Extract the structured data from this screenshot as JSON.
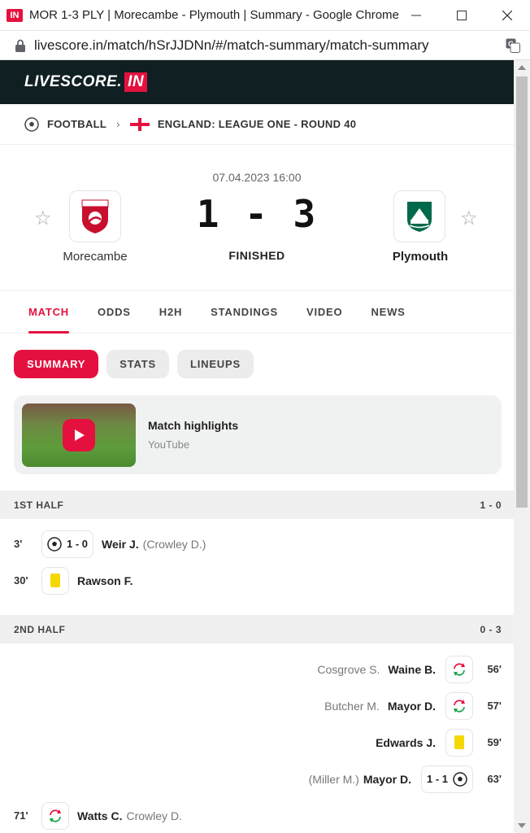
{
  "window": {
    "app_icon": "IN",
    "title": "MOR 1-3 PLY | Morecambe - Plymouth | Summary - Google Chrome",
    "url": "livescore.in/match/hSrJJDNn/#/match-summary/match-summary"
  },
  "brand": {
    "logo_text": "LIVESCORE.",
    "logo_in": "IN"
  },
  "breadcrumb": {
    "sport": "FOOTBALL",
    "competition": "ENGLAND: LEAGUE ONE - ROUND 40"
  },
  "match": {
    "datetime": "07.04.2023 16:00",
    "score": "1 - 3",
    "status": "FINISHED",
    "home": {
      "name": "Morecambe"
    },
    "away": {
      "name": "Plymouth"
    }
  },
  "tabs": [
    "MATCH",
    "ODDS",
    "H2H",
    "STANDINGS",
    "VIDEO",
    "NEWS"
  ],
  "subtabs": [
    "SUMMARY",
    "STATS",
    "LINEUPS"
  ],
  "highlights": {
    "title": "Match highlights",
    "source": "YouTube"
  },
  "first_half": {
    "label": "1ST HALF",
    "score": "1 - 0",
    "events": [
      {
        "minute": "3'",
        "type": "goal",
        "score": "1 - 0",
        "player": "Weir J.",
        "assist": "(Crowley D.)"
      },
      {
        "minute": "30'",
        "type": "yellow-card",
        "player": "Rawson F."
      }
    ]
  },
  "second_half": {
    "label": "2ND HALF",
    "score": "0 - 3",
    "events": [
      {
        "minute": "56'",
        "type": "substitution",
        "player": "Waine B.",
        "other": "Cosgrove S."
      },
      {
        "minute": "57'",
        "type": "substitution",
        "player": "Mayor D.",
        "other": "Butcher M."
      },
      {
        "minute": "59'",
        "type": "yellow-card",
        "player": "Edwards J."
      },
      {
        "minute": "63'",
        "type": "goal",
        "player": "Mayor D.",
        "other": "(Miller M.)",
        "score": "1 - 1"
      },
      {
        "minute": "71'",
        "type": "substitution",
        "player": "Watts C.",
        "other": "Crowley D."
      }
    ]
  },
  "colors": {
    "accent": "#e4113f",
    "brand_bg": "#0f1f22",
    "yellow": "#f5d800"
  }
}
